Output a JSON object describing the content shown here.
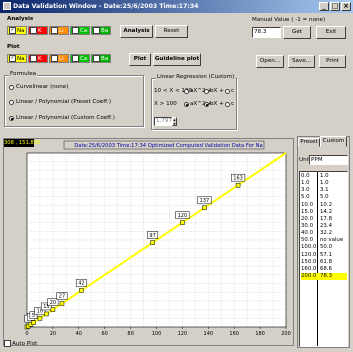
{
  "window": {
    "title": "Data Validation Window - Date:25/6/2003 Time:17:34"
  },
  "analysis": {
    "label": "Analysis",
    "elements": [
      {
        "name": "Na",
        "color": "#ffff00",
        "checked": true
      },
      {
        "name": "K",
        "color": "#ff0000",
        "checked": false
      },
      {
        "name": "Li",
        "color": "#ff8c00",
        "checked": false
      },
      {
        "name": "Ca",
        "color": "#00c000",
        "checked": false
      },
      {
        "name": "Ba",
        "color": "#00b000",
        "checked": false
      }
    ],
    "analysis_button": "Analysis",
    "reset_button": "Reset"
  },
  "plot": {
    "label": "Plot",
    "elements": [
      {
        "name": "Na",
        "color": "#ffff00",
        "checked": true
      },
      {
        "name": "K",
        "color": "#ff0000",
        "checked": true
      },
      {
        "name": "Li",
        "color": "#ff8c00",
        "checked": false
      },
      {
        "name": "Ca",
        "color": "#00c000",
        "checked": false
      },
      {
        "name": "Ba",
        "color": "#00b000",
        "checked": false
      }
    ],
    "plot_button": "Plot",
    "guideline_button": "Guideline plot"
  },
  "manual": {
    "label": "Manual Value ( -1 = none)",
    "value": "78.3",
    "get_button": "Get",
    "exit_button": "Exit"
  },
  "file_buttons": {
    "open": "Open...",
    "save": "Save...",
    "print": "Print"
  },
  "formulea": {
    "label": "Formulea",
    "options": [
      {
        "text": "Curvelinear (none)",
        "selected": false
      },
      {
        "text": "Linear / Polynomial (Preset Coeff.)",
        "selected": false
      },
      {
        "text": "Linear / Polynomial (Custom Coeff.)",
        "selected": true
      }
    ]
  },
  "regression": {
    "label": "Linear Regression (Custom)",
    "row1": {
      "range": "10 < X < 100",
      "opts": [
        {
          "t": "aX^2 +",
          "sel": false
        },
        {
          "t": "bX +",
          "sel": false
        },
        {
          "t": "c",
          "sel": false
        }
      ]
    },
    "row2": {
      "range": "X > 100",
      "opts": [
        {
          "t": "aX^2 +",
          "sel": true
        },
        {
          "t": "bX +",
          "sel": true
        },
        {
          "t": "c",
          "sel": false
        }
      ]
    },
    "coeff_value": "1.797"
  },
  "chart": {
    "cursor_readout": "308 , 151.826",
    "info": "Date:25/6/2003 Time:17:34  Optimized Computed Validation Data For Na",
    "autoplot_label": "Auto Plot"
  },
  "chart_data": {
    "type": "scatter",
    "title": "Date:25/6/2003 Time:17:34  Optimized Computed Validation Data For Na",
    "xlim": [
      0,
      200
    ],
    "ylim": [
      0,
      200
    ],
    "x_ticks": [
      0,
      20,
      40,
      60,
      80,
      100,
      120,
      140,
      160,
      180,
      200
    ],
    "grid": true,
    "line": {
      "x": [
        0,
        200
      ],
      "y": [
        0,
        200
      ],
      "color": "#ffff00"
    },
    "points": [
      {
        "x": 0,
        "y": 0,
        "label": ""
      },
      {
        "x": 1,
        "y": 1,
        "label": "1"
      },
      {
        "x": 3,
        "y": 3,
        "label": "3"
      },
      {
        "x": 5,
        "y": 5,
        "label": "5"
      },
      {
        "x": 10,
        "y": 10,
        "label": "10"
      },
      {
        "x": 15,
        "y": 15,
        "label": "15"
      },
      {
        "x": 20,
        "y": 20,
        "label": "20"
      },
      {
        "x": 27,
        "y": 27,
        "label": "27"
      },
      {
        "x": 42,
        "y": 42,
        "label": "42"
      },
      {
        "x": 97,
        "y": 97,
        "label": "97"
      },
      {
        "x": 120,
        "y": 120,
        "label": "120"
      },
      {
        "x": 137,
        "y": 137,
        "label": "137"
      },
      {
        "x": 163,
        "y": 163,
        "label": "163"
      }
    ]
  },
  "right_panel": {
    "tabs": [
      {
        "label": "Preset",
        "active": false
      },
      {
        "label": "Custom",
        "active": true
      }
    ],
    "units_label": "Units",
    "units_value": "PPM",
    "rows": [
      [
        "0.0",
        "1.0"
      ],
      [
        "1.0",
        "1.0"
      ],
      [
        "3.0",
        "3.1"
      ],
      [
        "5.0",
        "5.0"
      ],
      [
        "10.0",
        "10.2"
      ],
      [
        "15.0",
        "14.2"
      ],
      [
        "20.0",
        "17.8"
      ],
      [
        "30.0",
        "23.4"
      ],
      [
        "40.0",
        "32.2"
      ],
      [
        "50.0",
        "no value"
      ],
      [
        "100.0",
        "50.0"
      ],
      [
        "120.0",
        "57.1"
      ],
      [
        "150.0",
        "61.8"
      ],
      [
        "160.0",
        "68.6"
      ],
      [
        "200.0",
        "78.3"
      ]
    ],
    "selected_index": 14
  }
}
